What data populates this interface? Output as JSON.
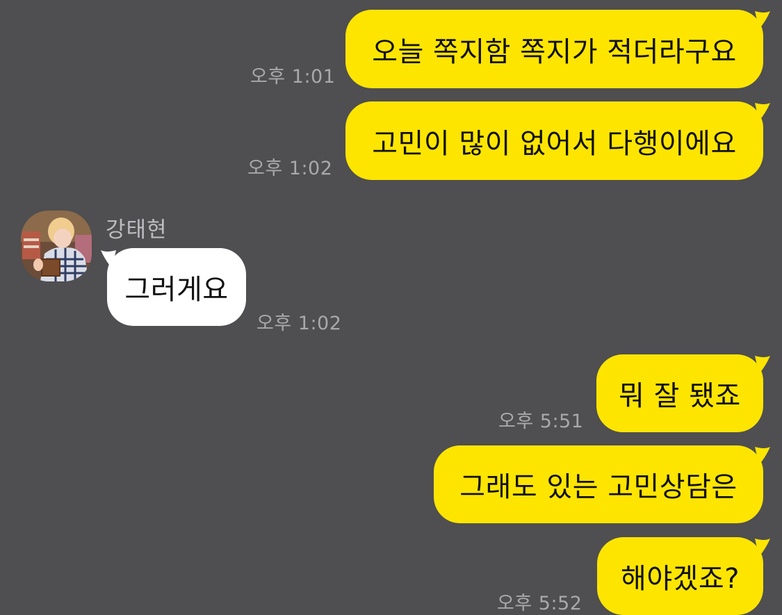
{
  "chat": {
    "sender_name": "강태현",
    "messages": [
      {
        "from": "me",
        "text": "오늘 쪽지함 쪽지가 적더라구요",
        "time": "오후 1:01"
      },
      {
        "from": "me",
        "text": "고민이 많이 없어서 다행이에요",
        "time": "오후 1:02"
      },
      {
        "from": "other",
        "text": "그러게요",
        "time": "오후 1:02"
      },
      {
        "from": "me",
        "text": "뭐 잘 됐죠",
        "time": "오후 5:51"
      },
      {
        "from": "me",
        "text": "그래도 있는 고민상담은",
        "time": ""
      },
      {
        "from": "me",
        "text": "해야겠죠?",
        "time": "오후 5:52"
      }
    ]
  },
  "colors": {
    "background": "#4f4e50",
    "my_bubble": "#fee500",
    "other_bubble": "#ffffff",
    "timestamp": "#a9a8ab"
  },
  "icons": {
    "avatar": "profile-photo"
  }
}
